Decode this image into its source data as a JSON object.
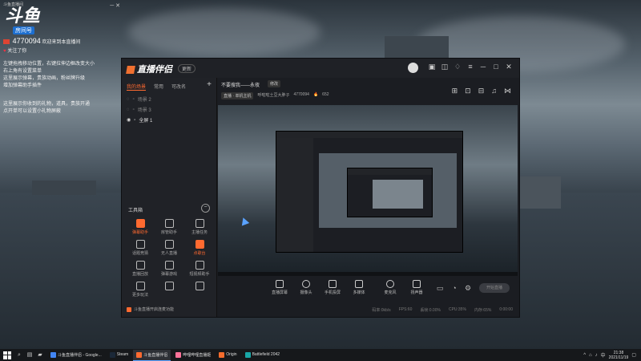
{
  "overlay": {
    "small_text": "斗鱼直播间",
    "logo": "斗鱼",
    "logo_tag": "房间号",
    "room_number": "4770094",
    "welcome": "欢迎来到本直播间",
    "follow": "关注了你",
    "tips": [
      "左键拖拽移动位置，右键拉伸边框改变大小",
      "右上角有设置菜单",
      "这里展示弹幕，贵族动画，粉丝牌升级",
      "增加弹幕助手插件",
      "这里展示你收到的礼物，道具，贵族开通",
      "点开单可以设置小礼物屏蔽"
    ]
  },
  "app": {
    "brand": "直播伴侣",
    "version_label": "更新",
    "left_tabs": [
      "我的场景",
      "常用",
      "可改名"
    ],
    "scenes": [
      "场景 2",
      "场景 3",
      "全屏 1"
    ],
    "toolbox_title": "工具箱",
    "tools": [
      {
        "label": "弹幕助手",
        "style": "or"
      },
      {
        "label": "房管助手",
        "style": "gr"
      },
      {
        "label": "主播任务",
        "style": "gr"
      },
      {
        "label": "话题竞猜",
        "style": "gr"
      },
      {
        "label": "无人直播",
        "style": "gr"
      },
      {
        "label": "点歌台",
        "style": "or"
      },
      {
        "label": "直播回放",
        "style": "gr"
      },
      {
        "label": "弹幕游戏",
        "style": "gr"
      },
      {
        "label": "短视频助手",
        "style": "gr"
      },
      {
        "label": "更多玩法",
        "style": "gr"
      },
      {
        "label": "",
        "style": "gr"
      },
      {
        "label": "",
        "style": "gr"
      }
    ],
    "hint": "斗鱼直播开启连麦功能",
    "room_title": "不要搜我——永夜",
    "edit_label": "修改",
    "category": "直播 · 单机主机",
    "streamer": "呼啦啦土豆大胖子",
    "room_id": "4770094",
    "hot": "652",
    "controls": [
      "直播屏幕",
      "摄像头",
      "手机投屏",
      "多媒体",
      "麦克风",
      "扬声器"
    ],
    "start_label": "开始直播",
    "status": [
      "码率:0kb/s",
      "FPS:60",
      "丢帧:0.00%",
      "CPU:35%",
      "内存:65%",
      "0:00:00"
    ]
  },
  "taskbar": {
    "apps": [
      {
        "label": "斗鱼直播伴侣 - Google...",
        "color": "#4285f4"
      },
      {
        "label": "Steam",
        "color": "#1b2838"
      },
      {
        "label": "斗鱼直播伴侣",
        "color": "#ff6a30",
        "active": true
      },
      {
        "label": "哔哩哔哩直播姬",
        "color": "#fb7299"
      },
      {
        "label": "Origin",
        "color": "#f56c2d"
      },
      {
        "label": "Battlefield 2042",
        "color": "#19a6a6"
      }
    ],
    "clock_time": "21:38",
    "clock_date": "2021/11/19"
  }
}
